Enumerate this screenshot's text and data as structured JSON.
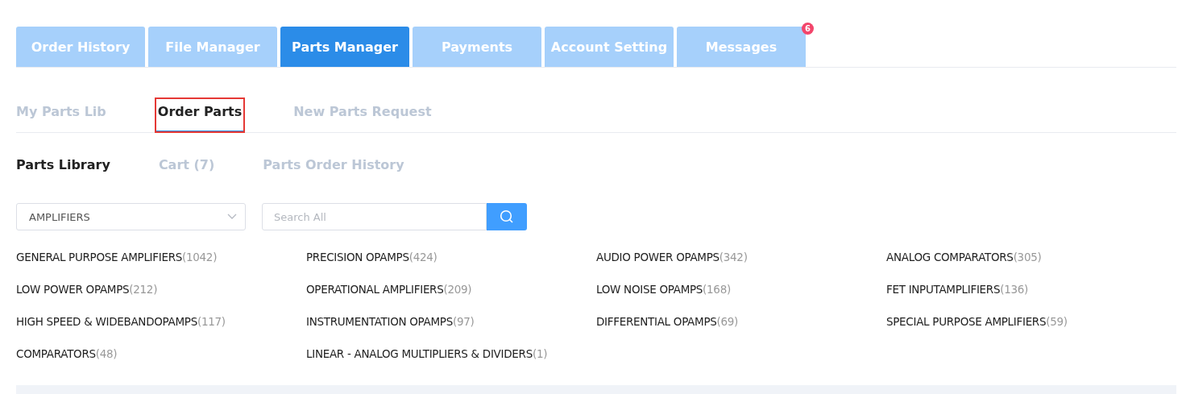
{
  "main_tabs": [
    {
      "label": "Order History",
      "selected": false
    },
    {
      "label": "File Manager",
      "selected": false
    },
    {
      "label": "Parts Manager",
      "selected": true
    },
    {
      "label": "Payments",
      "selected": false
    },
    {
      "label": "Account Setting",
      "selected": false
    },
    {
      "label": "Messages",
      "selected": false,
      "badge": "6"
    }
  ],
  "sub_tabs": [
    {
      "label": "My Parts Lib",
      "selected": false,
      "highlighted": false
    },
    {
      "label": "Order Parts",
      "selected": true,
      "highlighted": true
    },
    {
      "label": "New Parts Request",
      "selected": false,
      "highlighted": false
    }
  ],
  "section_tabs": [
    {
      "label": "Parts Library",
      "selected": true
    },
    {
      "label": "Cart (7)",
      "selected": false
    },
    {
      "label": "Parts Order History",
      "selected": false
    }
  ],
  "category_select": {
    "value": "AMPLIFIERS"
  },
  "search": {
    "placeholder": "Search All"
  },
  "categories": [
    {
      "name": "GENERAL PURPOSE AMPLIFIERS",
      "count": "(1042)"
    },
    {
      "name": "PRECISION OPAMPS",
      "count": "(424)"
    },
    {
      "name": "AUDIO POWER OPAMPS",
      "count": "(342)"
    },
    {
      "name": "ANALOG COMPARATORS",
      "count": "(305)"
    },
    {
      "name": "LOW POWER OPAMPS",
      "count": "(212)"
    },
    {
      "name": "OPERATIONAL AMPLIFIERS",
      "count": "(209)"
    },
    {
      "name": "LOW NOISE OPAMPS",
      "count": "(168)"
    },
    {
      "name": "FET INPUTAMPLIFIERS",
      "count": "(136)"
    },
    {
      "name": "HIGH SPEED & WIDEBANDOPAMPS",
      "count": "(117)"
    },
    {
      "name": "INSTRUMENTATION OPAMPS",
      "count": "(97)"
    },
    {
      "name": "DIFFERENTIAL OPAMPS",
      "count": "(69)"
    },
    {
      "name": "SPECIAL PURPOSE AMPLIFIERS",
      "count": "(59)"
    },
    {
      "name": "COMPARATORS",
      "count": "(48)"
    },
    {
      "name": "LINEAR - ANALOG MULTIPLIERS & DIVIDERS",
      "count": "(1)"
    }
  ]
}
